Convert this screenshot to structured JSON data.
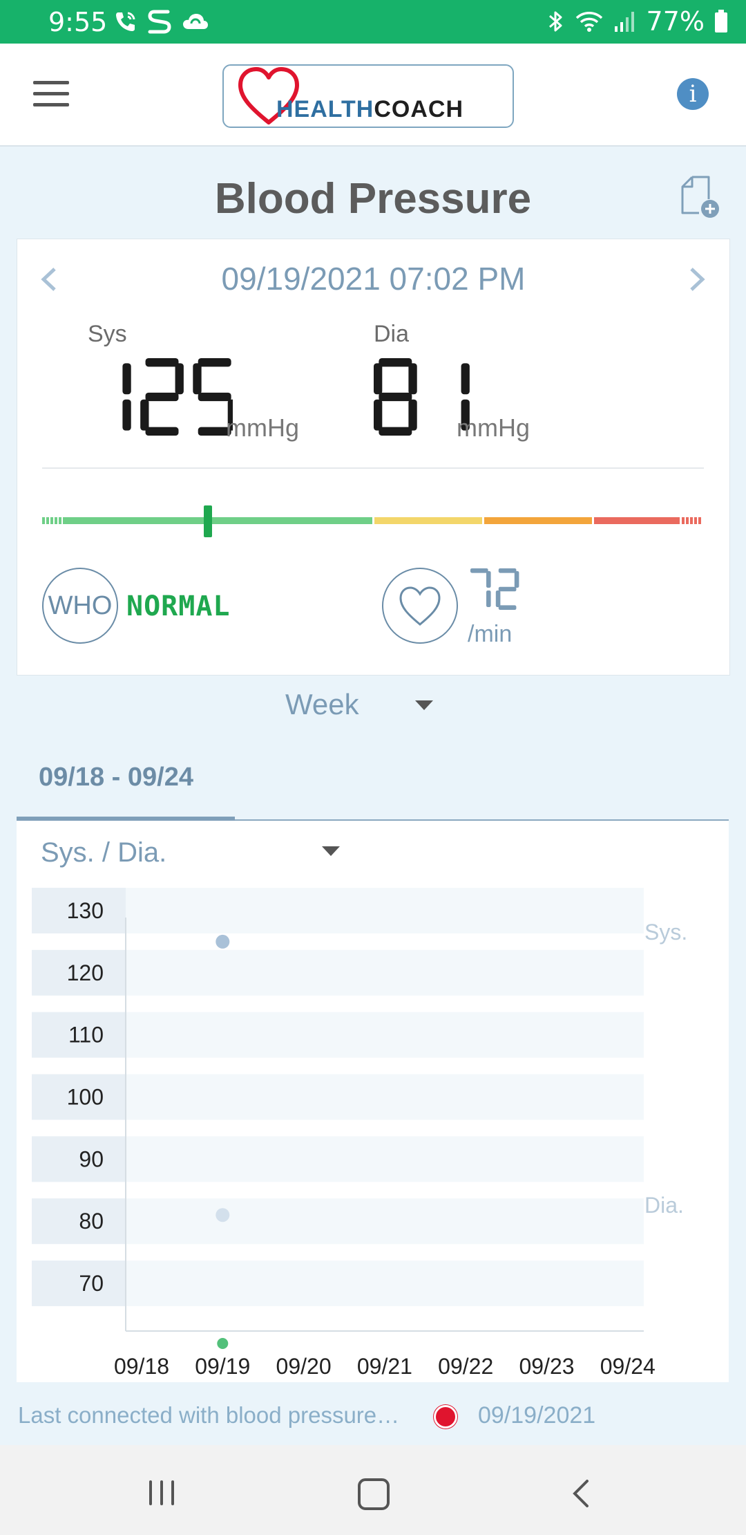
{
  "status_bar": {
    "time": "9:55",
    "battery": "77%",
    "icons": [
      "phone-wifi-call-icon",
      "s-app-icon",
      "cloud-sync-icon",
      "bluetooth-icon",
      "wifi-icon",
      "signal-icon",
      "battery-icon"
    ]
  },
  "app_bar": {
    "logo_word_1": "HEALTH",
    "logo_word_2": "COACH",
    "menu_icon": "menu-icon",
    "info_icon": "info-icon",
    "info_glyph": "i"
  },
  "page": {
    "title": "Blood Pressure",
    "add_record_icon": "add-document-icon"
  },
  "measurement": {
    "datetime": "09/19/2021 07:02 PM",
    "sys_label": "Sys",
    "sys_value": "125",
    "sys_unit": "mmHg",
    "dia_label": "Dia",
    "dia_value": "81",
    "dia_unit": "mmHg",
    "who_label": "WHO",
    "who_status": "NORMAL",
    "pulse_value": "72",
    "pulse_unit": "/min",
    "scale_marker_fraction": 0.25,
    "scale_colors": {
      "normal": "#6fcf87",
      "elevated": "#f3d66a",
      "stage1": "#f3a53b",
      "stage2": "#ea6a5e"
    }
  },
  "period": {
    "selected": "Week",
    "range_tab": "09/18 - 09/24"
  },
  "chart_selector": {
    "selected": "Sys. / Dia."
  },
  "chart_data": {
    "type": "scatter",
    "categories": [
      "09/18",
      "09/19",
      "09/20",
      "09/21",
      "09/22",
      "09/23",
      "09/24"
    ],
    "y_ticks": [
      130,
      120,
      110,
      100,
      90,
      80,
      70
    ],
    "ylim": [
      66,
      132
    ],
    "grid": true,
    "series": [
      {
        "name": "Sys.",
        "points": [
          {
            "x": "09/19",
            "y": 125
          }
        ],
        "color": "#a9c1d8"
      },
      {
        "name": "Dia.",
        "points": [
          {
            "x": "09/19",
            "y": 81
          }
        ],
        "color": "#d3e0ec"
      }
    ],
    "highlighted_day": "09/19",
    "highlight_color": "#52c07a"
  },
  "footer": {
    "message": "Last connected with blood pressure…",
    "date": "09/19/2021"
  },
  "nav_bar": {
    "recents_icon": "recents-icon",
    "home_icon": "home-icon",
    "back_icon": "back-icon"
  }
}
